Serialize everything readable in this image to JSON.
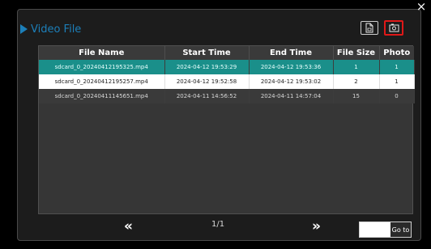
{
  "dialog": {
    "title": "Video File",
    "close_label": "×"
  },
  "toolbar": {
    "file_icon": "file-icon",
    "photo_icon": "photo-icon",
    "accent": "#1c7fb9",
    "photo_border": "#e01818"
  },
  "table": {
    "columns": [
      "File Name",
      "Start Time",
      "End Time",
      "File Size",
      "Photo"
    ],
    "rows": [
      {
        "file_name": "sdcard_0_20240412195325.mp4",
        "start_time": "2024-04-12 19:53:29",
        "end_time": "2024-04-12 19:53:36",
        "file_size": "1",
        "photo": "1",
        "state": "selected"
      },
      {
        "file_name": "sdcard_0_20240412195257.mp4",
        "start_time": "2024-04-12 19:52:58",
        "end_time": "2024-04-12 19:53:02",
        "file_size": "2",
        "photo": "1",
        "state": "highlighted"
      },
      {
        "file_name": "sdcard_0_20240411145651.mp4",
        "start_time": "2024-04-11 14:56:52",
        "end_time": "2024-04-11 14:57:04",
        "file_size": "15",
        "photo": "0",
        "state": "normal"
      }
    ],
    "selected_color": "#1a8f8a"
  },
  "pagination": {
    "prev_label": "«",
    "next_label": "»",
    "page_text": "1/1",
    "goto_value": "",
    "goto_label": "Go to"
  }
}
